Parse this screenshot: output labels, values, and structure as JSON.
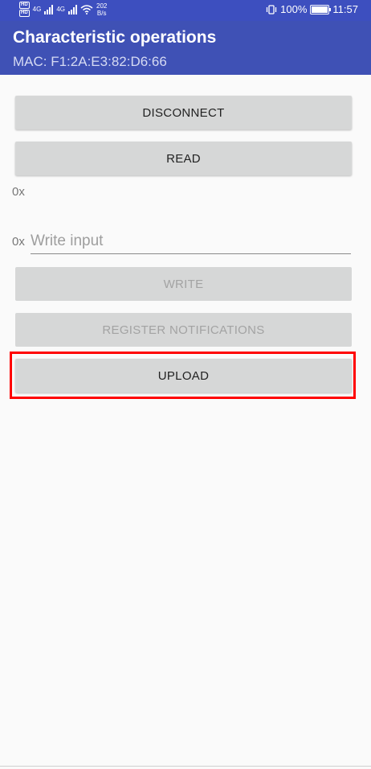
{
  "status_bar": {
    "net1": "4G",
    "net2": "4G",
    "speed_value": "202",
    "speed_unit": "B/s",
    "battery_percent": "100%",
    "battery_level": 1.0,
    "time": "11:57"
  },
  "app_bar": {
    "title": "Characteristic operations",
    "subtitle": "MAC: F1:2A:E3:82:D6:66"
  },
  "buttons": {
    "disconnect": "DISCONNECT",
    "read": "READ",
    "write": "WRITE",
    "register_notifications": "REGISTER NOTIFICATIONS",
    "upload": "UPLOAD"
  },
  "read_value_prefix": "0x",
  "write": {
    "prefix": "0x",
    "placeholder": "Write input",
    "value": ""
  },
  "colors": {
    "app_bar": "#3f51b5",
    "button": "#d6d7d7",
    "highlight": "#ff0000"
  }
}
